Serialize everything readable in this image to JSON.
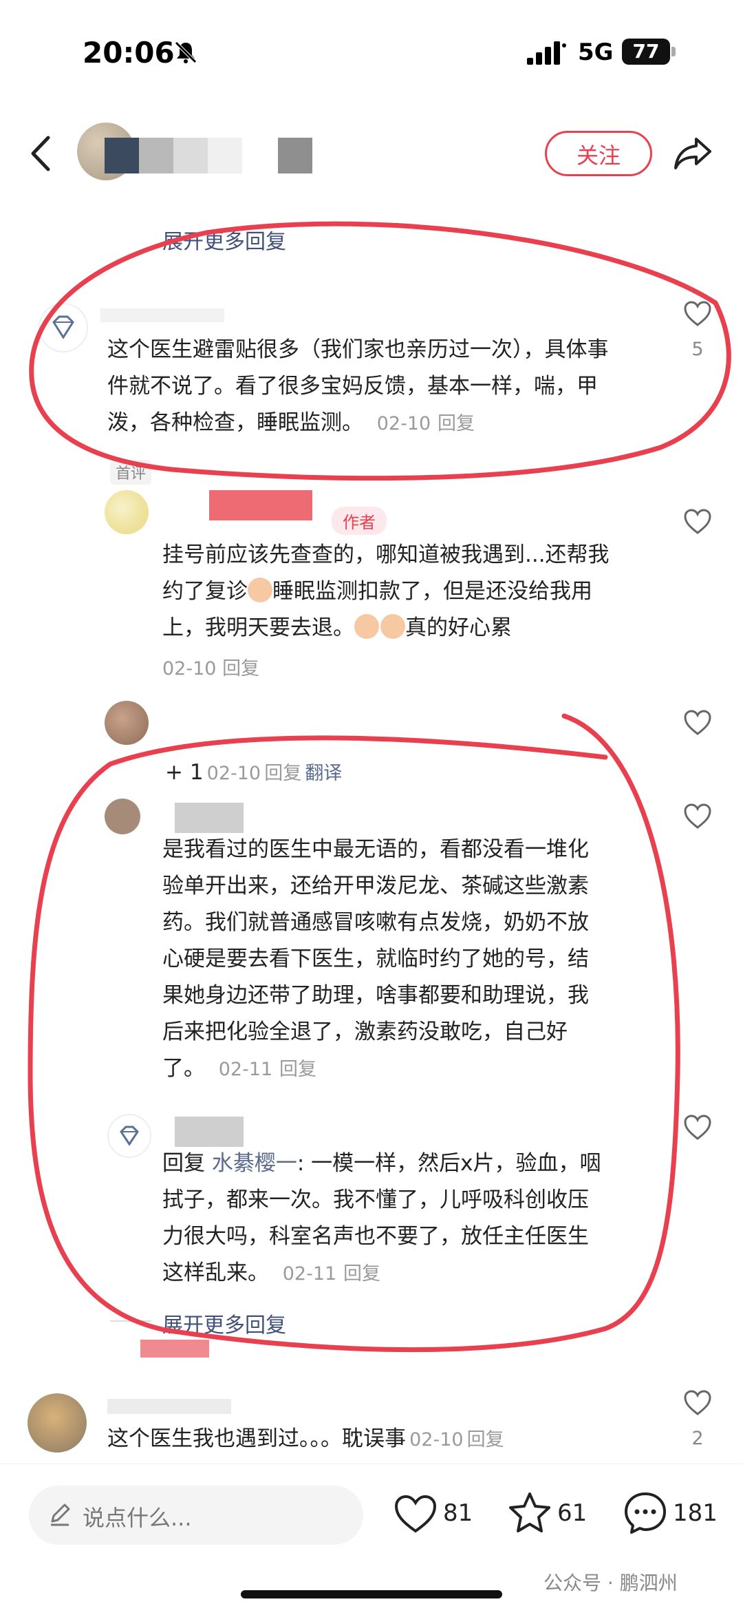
{
  "status_bar": {
    "time": "20:06",
    "network": "5G",
    "battery": "77"
  },
  "header": {
    "follow_label": "关注"
  },
  "comments": {
    "expand_top": "展开更多回复",
    "c1": {
      "text_lines": [
        "这个医生避雷贴很多（我们家也亲历过一次），具体事",
        "件就不说了。看了很多宝妈反馈，基本一样，喘，甲"
      ],
      "last_line": "泼，各种检查，睡眠监测。",
      "date": "02-10",
      "reply": "回复",
      "likes": "5",
      "tag": "首评"
    },
    "c2": {
      "author_tag": "作者",
      "line1": "挂号前应该先查查的，哪知道被我遇到...还帮我",
      "line2a": "约了复诊",
      "line2b": "睡眠监测扣款了，但是还没给我用",
      "line3a": "上，我明天要去退。",
      "line3b": "真的好心累",
      "date": "02-10",
      "reply": "回复"
    },
    "c3": {
      "text": "+ 1",
      "date": "02-10",
      "reply": "回复",
      "translate": "翻译"
    },
    "c4": {
      "text_lines": [
        "是我看过的医生中最无语的，看都没看一堆化",
        "验单开出来，还给开甲泼尼龙、茶碱这些激素",
        "药。我们就普通感冒咳嗽有点发烧，奶奶不放",
        "心硬是要去看下医生，就临时约了她的号，结",
        "果她身边还带了助理，啥事都要和助理说，我",
        "后来把化验全退了，激素药没敢吃，自己好"
      ],
      "last_line": "了。",
      "date": "02-11",
      "reply": "回复"
    },
    "c5": {
      "reply_prefix": "回复",
      "reply_to": "水綦樱一",
      "first_rest": ": 一模一样，然后x片，验血，咽",
      "text_lines": [
        "拭子，都来一次。我不懂了，儿呼吸科创收压",
        "力很大吗，科室名声也不要了，放任主任医生"
      ],
      "last_line": "这样乱来。",
      "date": "02-11",
      "reply": "回复"
    },
    "expand_bottom": "展开更多回复",
    "c6": {
      "text": "这个医生我也遇到过。。。耽误事",
      "date": "02-10",
      "reply": "回复",
      "likes": "2"
    }
  },
  "bottom_bar": {
    "input_placeholder": "说点什么...",
    "likes": "81",
    "stars": "61",
    "comments": "181"
  },
  "watermark": "公众号 · 鹏泗州",
  "colors": {
    "accent": "#e8404f",
    "link": "#5b6b8c",
    "annotation": "#e8404f"
  }
}
